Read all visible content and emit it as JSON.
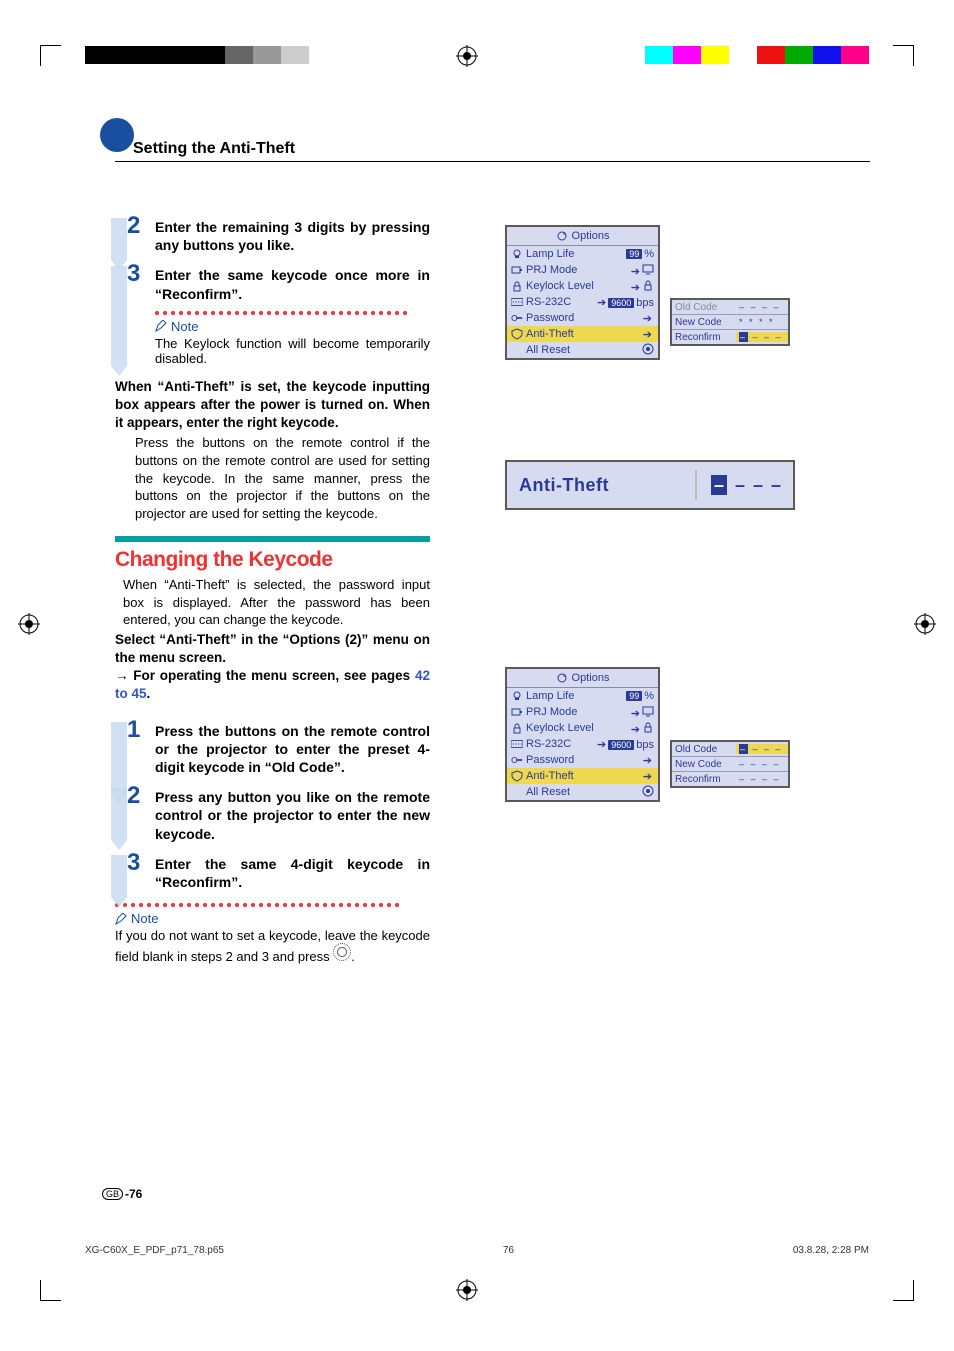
{
  "page": {
    "section_title": "Setting the Anti-Theft",
    "page_number": "-76",
    "gb": "GB"
  },
  "steps_a": [
    {
      "n": "2",
      "text": "Enter the remaining 3 digits by pressing any buttons you like."
    },
    {
      "n": "3",
      "text": "Enter the same keycode once more in “Reconfirm”."
    }
  ],
  "note_a": {
    "label": "Note",
    "body": "The Keylock function will become temporarily disabled."
  },
  "para_bold_a": "When “Anti-Theft” is set, the keycode inputting box appears after the power is turned on. When it appears, enter the right keycode.",
  "para_a": "Press the buttons on the remote control if the buttons on the remote control are used for setting the keycode. In the same manner, press the buttons on the projector if the buttons on the projector are used for setting the keycode.",
  "heading_b": "Changing the Keycode",
  "para_b1": "When “Anti-Theft” is selected, the password input box is displayed. After the password has been entered, you can change the keycode.",
  "para_b2_a": "Select “Anti-Theft” in the “Options (2)” menu on the menu screen.",
  "para_b2_b_prefix": "→ For operating the menu screen, see pages ",
  "para_b2_b_link": "42 to 45",
  "para_b2_b_suffix": ".",
  "steps_b": [
    {
      "n": "1",
      "text": "Press the buttons on the remote control or the projector to enter the preset 4-digit keycode in “Old Code”."
    },
    {
      "n": "2",
      "text": "Press any button you like on the remote control or the projector to enter the new keycode."
    },
    {
      "n": "3",
      "text": "Enter the same 4-digit keycode in “Reconfirm”."
    }
  ],
  "note_b": {
    "label": "Note",
    "body_prefix": "If you do not want to set a keycode, leave the keycode field blank in steps 2 and 3 and press ",
    "body_suffix": "."
  },
  "osd": {
    "title": "Options",
    "rows": [
      {
        "label": "Lamp Life",
        "right": "99",
        "unit": "%",
        "icon": "lamp"
      },
      {
        "label": "PRJ Mode",
        "right": "",
        "icon": "prj",
        "arrow": true,
        "r_icon": "screen"
      },
      {
        "label": "Keylock Level",
        "right": "",
        "icon": "lock",
        "arrow": true,
        "r_icon": "lock"
      },
      {
        "label": "RS-232C",
        "right": "9600",
        "unit": "bps",
        "icon": "rs",
        "arrow": true
      },
      {
        "label": "Password",
        "right": "",
        "icon": "key",
        "arrow": true
      },
      {
        "label": "Anti-Theft",
        "right": "",
        "icon": "shield",
        "arrow": true,
        "sel": true
      },
      {
        "label": "All Reset",
        "right": "",
        "icon": "",
        "r_icon": "reset"
      }
    ]
  },
  "code_panel_a": {
    "rows": [
      {
        "label": "Old Code",
        "val": "– – – –",
        "dim": true
      },
      {
        "label": "New Code",
        "val": "* * * *"
      },
      {
        "label": "Reconfirm",
        "val_cursor": "–",
        "val_rest": " – – –",
        "sel": true
      }
    ]
  },
  "code_panel_b": {
    "rows": [
      {
        "label": "Old Code",
        "val_cursor": "–",
        "val_rest": " – – –",
        "sel": true
      },
      {
        "label": "New Code",
        "val": "– – – –"
      },
      {
        "label": "Reconfirm",
        "val": "– – – –"
      }
    ]
  },
  "at_box": {
    "label": "Anti-Theft"
  },
  "footer": {
    "file": "XG-C60X_E_PDF_p71_78.p65",
    "page": "76",
    "date": "03.8.28, 2:28 PM"
  },
  "colorbar_left": [
    "#000",
    "#000",
    "#000",
    "#000",
    "#000",
    "#666",
    "#999",
    "#ccc"
  ],
  "colorbar_right": [
    "#0ff",
    "#f0f",
    "#ff0",
    "#fff",
    "#e11",
    "#0a0",
    "#11e",
    "#f08"
  ]
}
